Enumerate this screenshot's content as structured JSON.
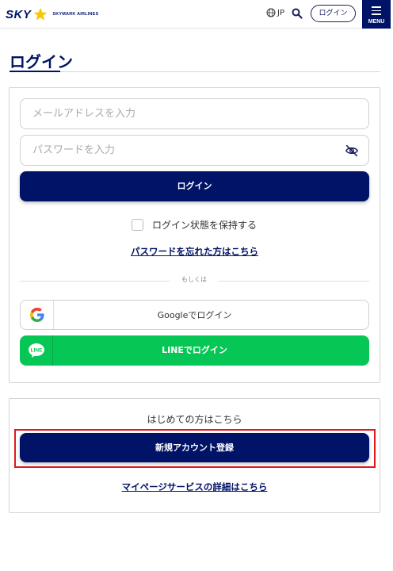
{
  "header": {
    "logo_sky": "SKY",
    "logo_airlines": "SKYMARK AIRLINES",
    "language": "JP",
    "login_label": "ログイン",
    "menu_label": "MENU"
  },
  "page": {
    "title": "ログイン"
  },
  "login_form": {
    "email_placeholder": "メールアドレスを入力",
    "password_placeholder": "パスワードを入力",
    "submit_label": "ログイン",
    "remember_label": "ログイン状態を保持する",
    "forgot_link": "パスワードを忘れた方はこちら",
    "divider_label": "もしくは",
    "google_label": "Googleでログイン",
    "line_label": "LINEでログイン",
    "line_icon_text": "LINE"
  },
  "register": {
    "first_time_text": "はじめての方はこちら",
    "register_label": "新規アカウント登録",
    "mypage_link": "マイページサービスの詳細はこちら"
  },
  "colors": {
    "brand_navy": "#001367",
    "line_green": "#06c755",
    "highlight_red": "#e0191f",
    "star_gold": "#f5c800"
  },
  "icons": [
    "globe-icon",
    "search-icon",
    "menu-icon",
    "eye-off-icon",
    "google-icon",
    "line-icon",
    "star-icon"
  ]
}
